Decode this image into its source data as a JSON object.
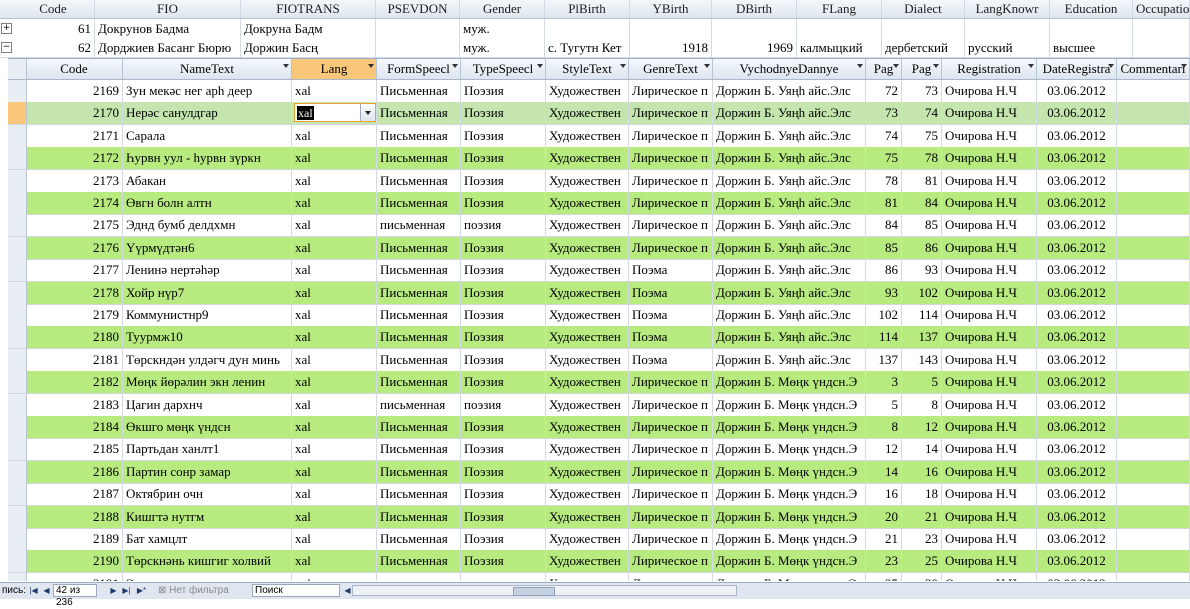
{
  "parent": {
    "columns": [
      "Code",
      "FIO",
      "FIOTRANS",
      "PSEVDON",
      "Gender",
      "PlBirth",
      "YBirth",
      "DBirth",
      "FLang",
      "Dialect",
      "LangKnowr",
      "Education",
      "Occupatio"
    ],
    "rows": [
      {
        "expander": "+",
        "code": "61",
        "fio": "Докрунов Бадма",
        "fiotrans": "Докруна Бадм",
        "psevdon": "",
        "gender": "муж.",
        "plbirth": "",
        "ybirth": "",
        "dbirth": "",
        "flang": "",
        "dialect": "",
        "langknown": "",
        "education": "",
        "occupation": ""
      },
      {
        "expander": "−",
        "code": "62",
        "fio": "Дорджиев Басанг Бюрю",
        "fiotrans": "Доржин Басң",
        "psevdon": "",
        "gender": "муж.",
        "plbirth": "с. Тугутн Кет",
        "ybirth": "1918",
        "dbirth": "1969",
        "flang": "калмыцкий",
        "dialect": "дербетский",
        "langknown": "русский",
        "education": "высшее",
        "occupation": ""
      }
    ]
  },
  "sub": {
    "columns": [
      "Code",
      "NameText",
      "Lang",
      "FormSpeecl",
      "TypeSpeecl",
      "StyleText",
      "GenreText",
      "VychodnyeDannye",
      "Pag",
      "Pag",
      "Registration",
      "DateRegistra",
      "Commentari"
    ],
    "current_lang_value": "xal",
    "rows": [
      {
        "code": "2169",
        "name": "Зун мекәс нег арһ деер",
        "lang": "xal",
        "form": "Письменная",
        "type": "Поэзия",
        "style": "Художествен",
        "genre": "Лирическое п",
        "vych": "Доржин Б. Уяңһ айс.Элс",
        "p1": "72",
        "p2": "73",
        "reg": "Очирова Н.Ч",
        "date": "03.06.2012",
        "comm": ""
      },
      {
        "code": "2170",
        "name": "Нерәс санулдгар",
        "lang": "",
        "form": "Письменная",
        "type": "Поэзия",
        "style": "Художествен",
        "genre": "Лирическое п",
        "vych": "Доржин Б. Уяңһ айс.Элс",
        "p1": "73",
        "p2": "74",
        "reg": "Очирова Н.Ч",
        "date": "03.06.2012",
        "comm": ""
      },
      {
        "code": "2171",
        "name": "Сарала",
        "lang": "xal",
        "form": "Письменная",
        "type": "Поэзия",
        "style": "Художествен",
        "genre": "Лирическое п",
        "vych": "Доржин Б. Уяңһ айс.Элс",
        "p1": "74",
        "p2": "75",
        "reg": "Очирова Н.Ч",
        "date": "03.06.2012",
        "comm": ""
      },
      {
        "code": "2172",
        "name": "Һурвн уул - һурвн зүркн",
        "lang": "xal",
        "form": "Письменная",
        "type": "Поэзия",
        "style": "Художествен",
        "genre": "Лирическое п",
        "vych": "Доржин Б. Уяңһ айс.Элс",
        "p1": "75",
        "p2": "78",
        "reg": "Очирова Н.Ч",
        "date": "03.06.2012",
        "comm": ""
      },
      {
        "code": "2173",
        "name": "Абакан",
        "lang": "xal",
        "form": "Письменная",
        "type": "Поэзия",
        "style": "Художествен",
        "genre": "Лирическое п",
        "vych": "Доржин Б. Уяңһ айс.Элс",
        "p1": "78",
        "p2": "81",
        "reg": "Очирова Н.Ч",
        "date": "03.06.2012",
        "comm": ""
      },
      {
        "code": "2174",
        "name": "Өвгн болн алтн",
        "lang": "xal",
        "form": "Письменная",
        "type": "Поэзия",
        "style": "Художествен",
        "genre": "Лирическое п",
        "vych": "Доржин Б. Уяңһ айс.Элс",
        "p1": "81",
        "p2": "84",
        "reg": "Очирова Н.Ч",
        "date": "03.06.2012",
        "comm": ""
      },
      {
        "code": "2175",
        "name": "Эднд бумб делдхмн",
        "lang": "xal",
        "form": "письменная",
        "type": "поэзия",
        "style": "Художествен",
        "genre": "Лирическое п",
        "vych": "Доржин Б. Уяңһ айс.Элс",
        "p1": "84",
        "p2": "85",
        "reg": "Очирова Н.Ч",
        "date": "03.06.2012",
        "comm": ""
      },
      {
        "code": "2176",
        "name": "Үүрмүдтән6",
        "lang": "xal",
        "form": "Письменная",
        "type": "Поэзия",
        "style": "Художествен",
        "genre": "Лирическое п",
        "vych": "Доржин Б. Уяңһ айс.Элс",
        "p1": "85",
        "p2": "86",
        "reg": "Очирова Н.Ч",
        "date": "03.06.2012",
        "comm": ""
      },
      {
        "code": "2177",
        "name": "Ленинә нертәһәр",
        "lang": "xal",
        "form": "Письменная",
        "type": "Поэзия",
        "style": "Художествен",
        "genre": "Поэма",
        "vych": "Доржин Б. Уяңһ айс.Элс",
        "p1": "86",
        "p2": "93",
        "reg": "Очирова Н.Ч",
        "date": "03.06.2012",
        "comm": ""
      },
      {
        "code": "2178",
        "name": "Хойр нүр7",
        "lang": "xal",
        "form": "Письменная",
        "type": "Поэзия",
        "style": "Художествен",
        "genre": "Поэма",
        "vych": "Доржин Б. Уяңһ айс.Элс",
        "p1": "93",
        "p2": "102",
        "reg": "Очирова Н.Ч",
        "date": "03.06.2012",
        "comm": ""
      },
      {
        "code": "2179",
        "name": "Коммунистнр9",
        "lang": "xal",
        "form": "Письменная",
        "type": "Поэзия",
        "style": "Художествен",
        "genre": "Поэма",
        "vych": "Доржин Б. Уяңһ айс.Элс",
        "p1": "102",
        "p2": "114",
        "reg": "Очирова Н.Ч",
        "date": "03.06.2012",
        "comm": ""
      },
      {
        "code": "2180",
        "name": "Туурмж10",
        "lang": "xal",
        "form": "Письменная",
        "type": "Поэзия",
        "style": "Художествен",
        "genre": "Поэма",
        "vych": "Доржин Б. Уяңһ айс.Элс",
        "p1": "114",
        "p2": "137",
        "reg": "Очирова Н.Ч",
        "date": "03.06.2012",
        "comm": ""
      },
      {
        "code": "2181",
        "name": "Төрскндән улдәгч дун минь",
        "lang": "xal",
        "form": "Письменная",
        "type": "Поэзия",
        "style": "Художествен",
        "genre": "Поэма",
        "vych": "Доржин Б. Уяңһ айс.Элс",
        "p1": "137",
        "p2": "143",
        "reg": "Очирова Н.Ч",
        "date": "03.06.2012",
        "comm": ""
      },
      {
        "code": "2182",
        "name": "Мөңк йөрәлин экн ленин",
        "lang": "xal",
        "form": "Письменная",
        "type": "Поэзия",
        "style": "Художествен",
        "genre": "Лирическое п",
        "vych": "Доржин Б. Мөңк үндсн.Э",
        "p1": "3",
        "p2": "5",
        "reg": "Очирова Н.Ч",
        "date": "03.06.2012",
        "comm": ""
      },
      {
        "code": "2183",
        "name": "Цагин дархнч",
        "lang": "xal",
        "form": "письменная",
        "type": "поэзия",
        "style": "Художествен",
        "genre": "Лирическое п",
        "vych": "Доржин Б. Мөңк үндсн.Э",
        "p1": "5",
        "p2": "8",
        "reg": "Очирова Н.Ч",
        "date": "03.06.2012",
        "comm": ""
      },
      {
        "code": "2184",
        "name": "Өкшго мөңк үндсн",
        "lang": "xal",
        "form": "Письменная",
        "type": "Поэзия",
        "style": "Художествен",
        "genre": "Лирическое п",
        "vych": "Доржин Б. Мөңк үндсн.Э",
        "p1": "8",
        "p2": "12",
        "reg": "Очирова Н.Ч",
        "date": "03.06.2012",
        "comm": ""
      },
      {
        "code": "2185",
        "name": "Партьдан ханлт1",
        "lang": "xal",
        "form": "Письменная",
        "type": "Поэзия",
        "style": "Художествен",
        "genre": "Лирическое п",
        "vych": "Доржин Б. Мөңк үндсн.Э",
        "p1": "12",
        "p2": "14",
        "reg": "Очирова Н.Ч",
        "date": "03.06.2012",
        "comm": ""
      },
      {
        "code": "2186",
        "name": "Партин сонр замар",
        "lang": "xal",
        "form": "Письменная",
        "type": "Поэзия",
        "style": "Художествен",
        "genre": "Лирическое п",
        "vych": "Доржин Б. Мөңк үндсн.Э",
        "p1": "14",
        "p2": "16",
        "reg": "Очирова Н.Ч",
        "date": "03.06.2012",
        "comm": ""
      },
      {
        "code": "2187",
        "name": "Октябрин очн",
        "lang": "xal",
        "form": "Письменная",
        "type": "Поэзия",
        "style": "Художествен",
        "genre": "Лирическое п",
        "vych": "Доржин Б. Мөңк үндсн.Э",
        "p1": "16",
        "p2": "18",
        "reg": "Очирова Н.Ч",
        "date": "03.06.2012",
        "comm": ""
      },
      {
        "code": "2188",
        "name": "Кишгтә нутгм",
        "lang": "xal",
        "form": "Письменная",
        "type": "Поэзия",
        "style": "Художествен",
        "genre": "Лирическое п",
        "vych": "Доржин Б. Мөңк үндсн.Э",
        "p1": "20",
        "p2": "21",
        "reg": "Очирова Н.Ч",
        "date": "03.06.2012",
        "comm": ""
      },
      {
        "code": "2189",
        "name": "Бат хамцлт",
        "lang": "xal",
        "form": "Письменная",
        "type": "Поэзия",
        "style": "Художествен",
        "genre": "Лирическое п",
        "vych": "Доржин Б. Мөңк үндсн.Э",
        "p1": "21",
        "p2": "23",
        "reg": "Очирова Н.Ч",
        "date": "03.06.2012",
        "comm": ""
      },
      {
        "code": "2190",
        "name": "Төрскнәнь кишгиг холвий",
        "lang": "xal",
        "form": "Письменная",
        "type": "Поэзия",
        "style": "Художествен",
        "genre": "Лирическое п",
        "vych": "Доржин Б. Мөңк үндсн.Э",
        "p1": "23",
        "p2": "25",
        "reg": "Очирова Н.Ч",
        "date": "03.06.2012",
        "comm": ""
      },
      {
        "code": "2191",
        "name": "Эн мини төрскн нутгм",
        "lang": "xal",
        "form": "письменная",
        "type": "поэзия",
        "style": "Художествен",
        "genre": "Лирическое п",
        "vych": "Доржин Б. Мөңк үндсн.Э",
        "p1": "25",
        "p2": "30",
        "reg": "Очирова Н.Ч",
        "date": "03.06.2012",
        "comm": ""
      }
    ]
  },
  "nav": {
    "records_label": "пись:",
    "record_counter": "42 из 236",
    "filter_label": "Нет фильтра",
    "search_label": "Поиск"
  },
  "colors": {
    "alt_row": "#b7ea7f",
    "current_row": "#c4e5ae",
    "selected_header": "#f8c77a"
  }
}
